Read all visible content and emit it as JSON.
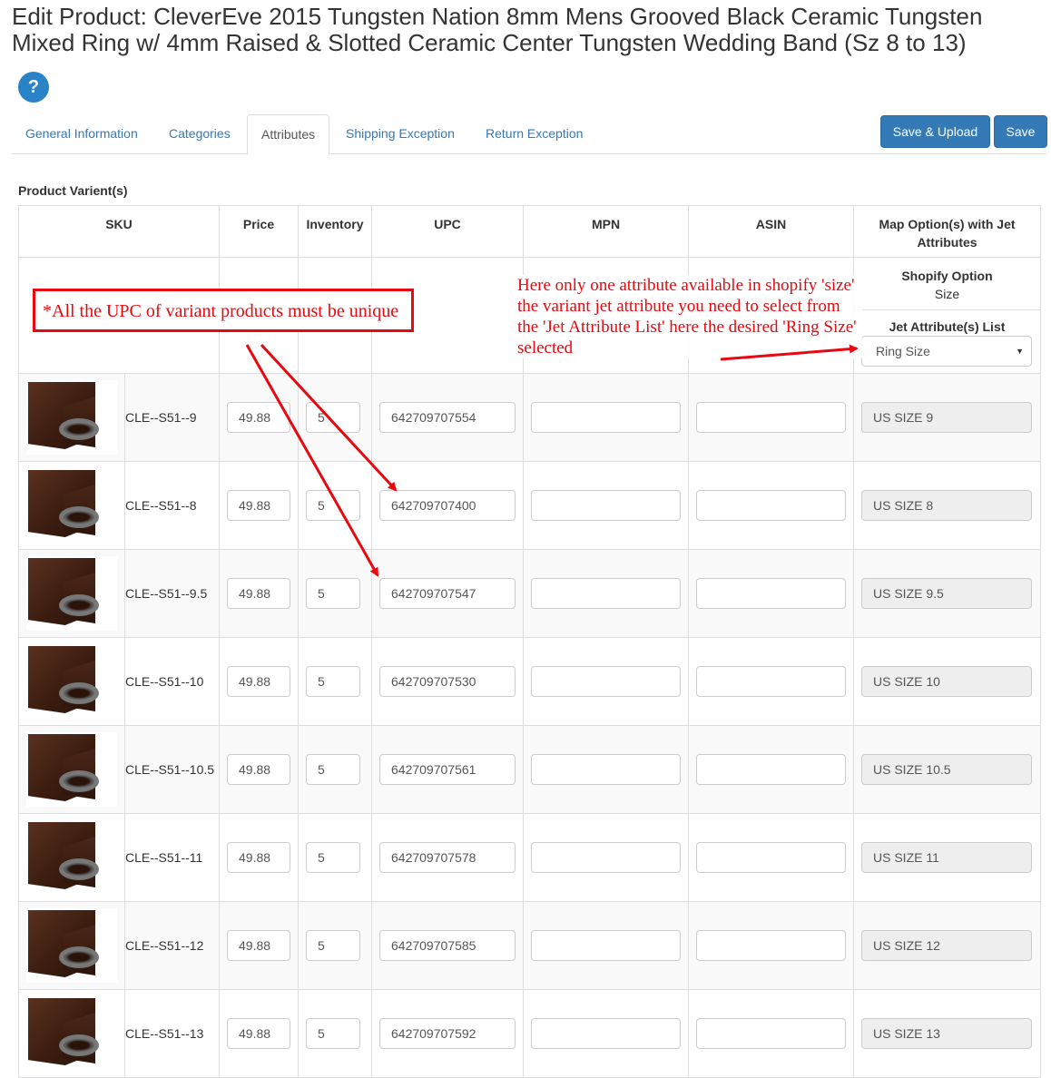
{
  "page": {
    "title": "Edit Product: CleverEve 2015 Tungsten Nation 8mm Mens Grooved Black Ceramic Tungsten Mixed Ring w/ 4mm Raised & Slotted Ceramic Center Tungsten Wedding Band (Sz 8 to 13)",
    "help_label": "?"
  },
  "tabs": [
    {
      "label": "General Information"
    },
    {
      "label": "Categories"
    },
    {
      "label": "Attributes"
    },
    {
      "label": "Shipping Exception"
    },
    {
      "label": "Return Exception"
    }
  ],
  "actions": {
    "save_upload": "Save & Upload",
    "save": "Save"
  },
  "section_label": "Product Varient(s)",
  "columns": {
    "sku": "SKU",
    "price": "Price",
    "inventory": "Inventory",
    "upc": "UPC",
    "mpn": "MPN",
    "asin": "ASIN",
    "map": "Map Option(s) with Jet Attributes"
  },
  "mapping": {
    "shopify_option_label": "Shopify Option",
    "shopify_option_value": "Size",
    "jet_list_label": "Jet Attribute(s) List",
    "jet_selected": "Ring Size"
  },
  "variants": [
    {
      "sku": "CLE--S51--9",
      "price": "49.88",
      "inventory": "5",
      "upc": "642709707554",
      "mpn": "",
      "asin": "",
      "jet_value": "US SIZE 9"
    },
    {
      "sku": "CLE--S51--8",
      "price": "49.88",
      "inventory": "5",
      "upc": "642709707400",
      "mpn": "",
      "asin": "",
      "jet_value": "US SIZE 8"
    },
    {
      "sku": "CLE--S51--9.5",
      "price": "49.88",
      "inventory": "5",
      "upc": "642709707547",
      "mpn": "",
      "asin": "",
      "jet_value": "US SIZE 9.5"
    },
    {
      "sku": "CLE--S51--10",
      "price": "49.88",
      "inventory": "5",
      "upc": "642709707530",
      "mpn": "",
      "asin": "",
      "jet_value": "US SIZE 10"
    },
    {
      "sku": "CLE--S51--10.5",
      "price": "49.88",
      "inventory": "5",
      "upc": "642709707561",
      "mpn": "",
      "asin": "",
      "jet_value": "US SIZE 10.5"
    },
    {
      "sku": "CLE--S51--11",
      "price": "49.88",
      "inventory": "5",
      "upc": "642709707578",
      "mpn": "",
      "asin": "",
      "jet_value": "US SIZE 11"
    },
    {
      "sku": "CLE--S51--12",
      "price": "49.88",
      "inventory": "5",
      "upc": "642709707585",
      "mpn": "",
      "asin": "",
      "jet_value": "US SIZE 12"
    },
    {
      "sku": "CLE--S51--13",
      "price": "49.88",
      "inventory": "5",
      "upc": "642709707592",
      "mpn": "",
      "asin": "",
      "jet_value": "US SIZE 13"
    }
  ],
  "annotations": {
    "upc_note": "*All the UPC of variant products must be unique",
    "attribute_note": "Here only one attribute available in shopify 'size' the variant jet attribute you need to select from the 'Jet Attribute List' here the desired 'Ring Size' selected",
    "color": "#e8080f"
  }
}
